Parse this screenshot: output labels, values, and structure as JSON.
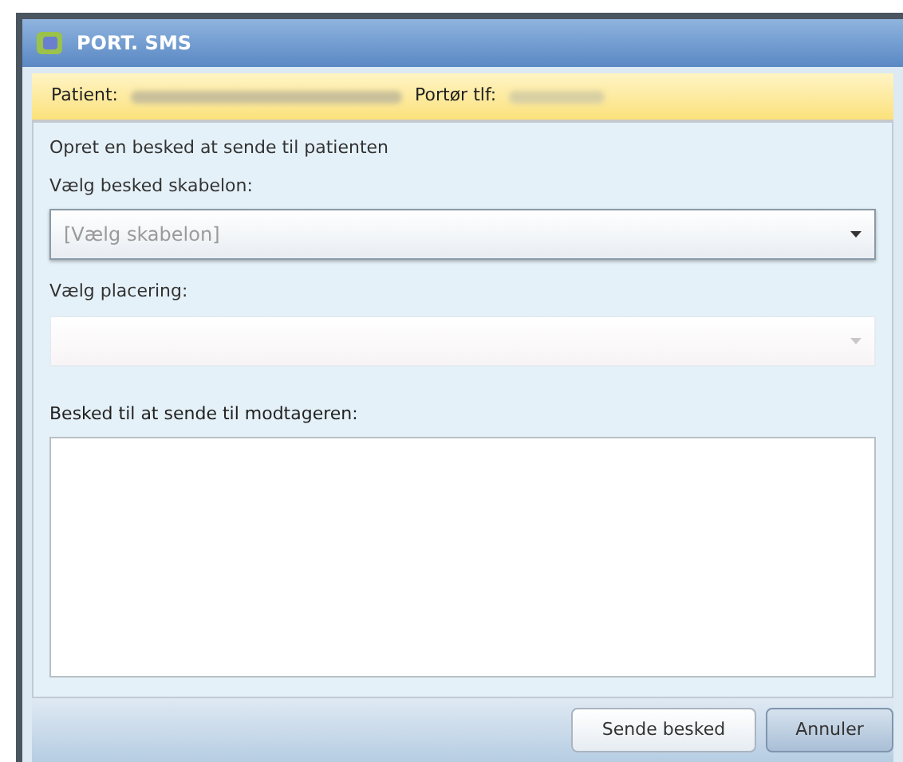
{
  "window": {
    "title": "PORT. SMS"
  },
  "info_bar": {
    "patient_label": "Patient:",
    "porter_label": "Portør tlf:"
  },
  "intro": "Opret en besked at sende til patienten",
  "template_field": {
    "label": "Vælg besked skabelon:",
    "placeholder": "[Vælg skabelon]",
    "disabled": false
  },
  "location_field": {
    "label": "Vælg placering:",
    "disabled": true
  },
  "message_field": {
    "label": "Besked til at sende til modtageren:"
  },
  "buttons": [
    {
      "label": "Sende besked",
      "kind": "primary"
    },
    {
      "label": "Annuler",
      "kind": "secondary"
    }
  ]
}
